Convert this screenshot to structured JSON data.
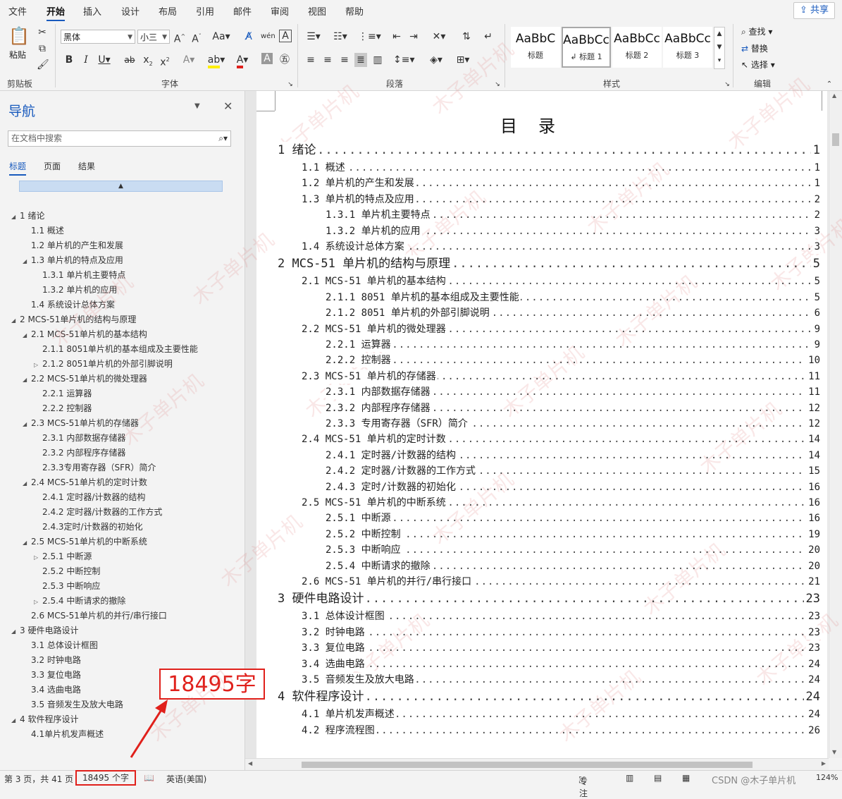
{
  "menu": {
    "tabs": [
      "文件",
      "开始",
      "插入",
      "设计",
      "布局",
      "引用",
      "邮件",
      "审阅",
      "视图",
      "帮助"
    ],
    "active": "开始",
    "share": "共享"
  },
  "ribbon": {
    "clipboard": {
      "paste": "粘贴",
      "label": "剪贴板"
    },
    "font": {
      "family": "黑体",
      "size": "小三",
      "label": "字体",
      "buttons": [
        "A^",
        "A˅",
        "Aa",
        "B",
        "I",
        "U",
        "abc",
        "x₂",
        "x²",
        "A",
        "A"
      ]
    },
    "paragraph": {
      "label": "段落"
    },
    "styles": {
      "label": "样式",
      "items": [
        {
          "sample": "AaBbC",
          "name": "标题"
        },
        {
          "sample": "AaBbCc",
          "name": "↲ 标题 1"
        },
        {
          "sample": "AaBbCc",
          "name": "标题 2"
        },
        {
          "sample": "AaBbCc",
          "name": "标题 3"
        }
      ]
    },
    "editing": {
      "find": "查找",
      "replace": "替换",
      "select": "选择",
      "label": "编辑"
    }
  },
  "nav": {
    "title": "导航",
    "search_placeholder": "在文档中搜索",
    "tabs": [
      "标题",
      "页面",
      "结果"
    ],
    "items": [
      {
        "text": "1 绪论",
        "twisty": "◢"
      },
      {
        "text": "1.1 概述",
        "twisty": ""
      },
      {
        "text": "1.2 单片机的产生和发展",
        "twisty": ""
      },
      {
        "text": "1.3 单片机的特点及应用",
        "twisty": "◢"
      },
      {
        "text": "1.3.1 单片机主要特点",
        "twisty": ""
      },
      {
        "text": "1.3.2 单片机的应用",
        "twisty": ""
      },
      {
        "text": "1.4 系统设计总体方案",
        "twisty": ""
      },
      {
        "text": "2 MCS-51单片机的结构与原理",
        "twisty": "◢"
      },
      {
        "text": "2.1 MCS-51单片机的基本结构",
        "twisty": "◢"
      },
      {
        "text": "2.1.1 8051单片机的基本组成及主要性能",
        "twisty": ""
      },
      {
        "text": "2.1.2 8051单片机的外部引脚说明",
        "twisty": "▷"
      },
      {
        "text": "2.2 MCS-51单片机的微处理器",
        "twisty": "◢"
      },
      {
        "text": "2.2.1 运算器",
        "twisty": ""
      },
      {
        "text": "2.2.2 控制器",
        "twisty": ""
      },
      {
        "text": "2.3 MCS-51单片机的存储器",
        "twisty": "◢"
      },
      {
        "text": "2.3.1 内部数据存储器",
        "twisty": ""
      },
      {
        "text": "2.3.2 内部程序存储器",
        "twisty": ""
      },
      {
        "text": "2.3.3专用寄存器（SFR）简介",
        "twisty": ""
      },
      {
        "text": "2.4 MCS-51单片机的定时计数",
        "twisty": "◢"
      },
      {
        "text": "2.4.1 定时器/计数器的结构",
        "twisty": ""
      },
      {
        "text": "2.4.2 定时器/计数器的工作方式",
        "twisty": ""
      },
      {
        "text": "2.4.3定时/计数器的初始化",
        "twisty": ""
      },
      {
        "text": "2.5 MCS-51单片机的中断系统",
        "twisty": "◢"
      },
      {
        "text": "2.5.1 中断源",
        "twisty": "▷"
      },
      {
        "text": "2.5.2 中断控制",
        "twisty": ""
      },
      {
        "text": "2.5.3 中断响应",
        "twisty": ""
      },
      {
        "text": "2.5.4 中断请求的撤除",
        "twisty": "▷"
      },
      {
        "text": "2.6 MCS-51单片机的并行/串行接口",
        "twisty": ""
      },
      {
        "text": "3 硬件电路设计",
        "twisty": "◢"
      },
      {
        "text": "3.1 总体设计框图",
        "twisty": ""
      },
      {
        "text": "3.2 时钟电路",
        "twisty": ""
      },
      {
        "text": "3.3 复位电路",
        "twisty": ""
      },
      {
        "text": "3.4 选曲电路",
        "twisty": ""
      },
      {
        "text": "3.5 音频发生及放大电路",
        "twisty": ""
      },
      {
        "text": "4 软件程序设计",
        "twisty": "◢"
      },
      {
        "text": "4.1单片机发声概述",
        "twisty": ""
      }
    ]
  },
  "document": {
    "toc_title": "目录",
    "entries": [
      {
        "level": 1,
        "text": "1 绪论",
        "page": "1"
      },
      {
        "level": 2,
        "text": "1.1 概述",
        "page": "1"
      },
      {
        "level": 2,
        "text": "1.2 单片机的产生和发展",
        "page": "1"
      },
      {
        "level": 2,
        "text": "1.3 单片机的特点及应用",
        "page": "2"
      },
      {
        "level": 3,
        "text": "1.3.1 单片机主要特点",
        "page": "2"
      },
      {
        "level": 3,
        "text": "1.3.2 单片机的应用",
        "page": "3"
      },
      {
        "level": 2,
        "text": "1.4 系统设计总体方案",
        "page": "3"
      },
      {
        "level": 1,
        "text": "2 MCS-51 单片机的结构与原理",
        "page": "5"
      },
      {
        "level": 2,
        "text": "2.1 MCS-51 单片机的基本结构",
        "page": "5"
      },
      {
        "level": 3,
        "text": "2.1.1 8051 单片机的基本组成及主要性能",
        "page": "5"
      },
      {
        "level": 3,
        "text": "2.1.2 8051 单片机的外部引脚说明",
        "page": "6"
      },
      {
        "level": 2,
        "text": "2.2 MCS-51 单片机的微处理器",
        "page": "9"
      },
      {
        "level": 3,
        "text": "2.2.1 运算器",
        "page": "9"
      },
      {
        "level": 3,
        "text": "2.2.2 控制器",
        "page": "10"
      },
      {
        "level": 2,
        "text": "2.3 MCS-51 单片机的存储器",
        "page": "11"
      },
      {
        "level": 3,
        "text": "2.3.1 内部数据存储器",
        "page": "11"
      },
      {
        "level": 3,
        "text": "2.3.2 内部程序存储器",
        "page": "12"
      },
      {
        "level": 3,
        "text": "2.3.3 专用寄存器（SFR）简介",
        "page": "12"
      },
      {
        "level": 2,
        "text": "2.4 MCS-51 单片机的定时计数",
        "page": "14"
      },
      {
        "level": 3,
        "text": "2.4.1 定时器/计数器的结构",
        "page": "14"
      },
      {
        "level": 3,
        "text": "2.4.2 定时器/计数器的工作方式",
        "page": "15"
      },
      {
        "level": 3,
        "text": "2.4.3 定时/计数器的初始化",
        "page": "16"
      },
      {
        "level": 2,
        "text": "2.5 MCS-51 单片机的中断系统",
        "page": "16"
      },
      {
        "level": 3,
        "text": "2.5.1 中断源",
        "page": "16"
      },
      {
        "level": 3,
        "text": "2.5.2 中断控制",
        "page": "19"
      },
      {
        "level": 3,
        "text": "2.5.3 中断响应",
        "page": "20"
      },
      {
        "level": 3,
        "text": "2.5.4 中断请求的撤除",
        "page": "20"
      },
      {
        "level": 2,
        "text": "2.6 MCS-51 单片机的并行/串行接口",
        "page": "21"
      },
      {
        "level": 1,
        "text": "3 硬件电路设计",
        "page": "23"
      },
      {
        "level": 2,
        "text": "3.1 总体设计框图",
        "page": "23"
      },
      {
        "level": 2,
        "text": "3.2 时钟电路",
        "page": "23"
      },
      {
        "level": 2,
        "text": "3.3 复位电路",
        "page": "23"
      },
      {
        "level": 2,
        "text": "3.4 选曲电路",
        "page": "24"
      },
      {
        "level": 2,
        "text": "3.5 音频发生及放大电路",
        "page": "24"
      },
      {
        "level": 1,
        "text": "4 软件程序设计",
        "page": "24"
      },
      {
        "level": 2,
        "text": "4.1 单片机发声概述",
        "page": "24"
      },
      {
        "level": 2,
        "text": "4.2 程序流程图",
        "page": "26"
      }
    ]
  },
  "status": {
    "page": "第 3 页，共 41 页",
    "words": "18495 个字",
    "language": "英语(美国)",
    "focus": "专注",
    "zoom": "124%"
  },
  "annotation": {
    "callout": "18495字"
  },
  "watermark": {
    "text": "木子单片机",
    "credit": "CSDN @木子单片机"
  }
}
